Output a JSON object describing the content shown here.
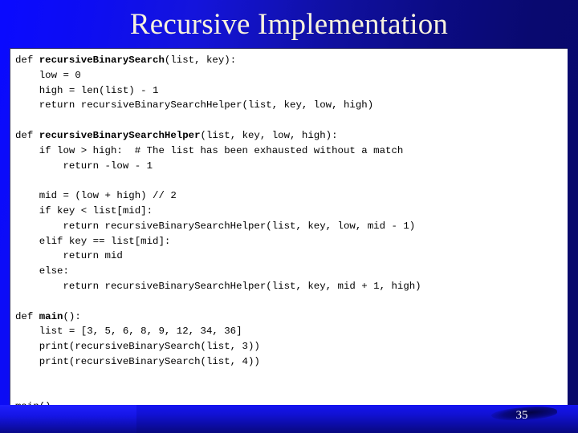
{
  "slide": {
    "title": "Recursive Implementation",
    "page_number": "35",
    "background_color_left": "#0a0aff",
    "background_color_right": "#08086a",
    "title_color": "#f7f2dd",
    "panel_background": "#ffffff",
    "code_text_color": "#000000"
  },
  "code": {
    "language": "python",
    "lines": [
      {
        "indent": 0,
        "prefix": "def ",
        "bold": "recursiveBinarySearch",
        "suffix": "(list, key):"
      },
      {
        "indent": 1,
        "prefix": "low = 0",
        "bold": "",
        "suffix": ""
      },
      {
        "indent": 1,
        "prefix": "high = len(list) - 1",
        "bold": "",
        "suffix": ""
      },
      {
        "indent": 1,
        "prefix": "return recursiveBinarySearchHelper(list, key, low, high)",
        "bold": "",
        "suffix": ""
      },
      {
        "indent": 0,
        "prefix": "",
        "bold": "",
        "suffix": ""
      },
      {
        "indent": 0,
        "prefix": "def ",
        "bold": "recursiveBinarySearchHelper",
        "suffix": "(list, key, low, high):"
      },
      {
        "indent": 1,
        "prefix": "if low > high:  # The list has been exhausted without a match",
        "bold": "",
        "suffix": ""
      },
      {
        "indent": 2,
        "prefix": "return -low - 1",
        "bold": "",
        "suffix": ""
      },
      {
        "indent": 0,
        "prefix": "",
        "bold": "",
        "suffix": ""
      },
      {
        "indent": 1,
        "prefix": "mid = (low + high) // 2",
        "bold": "",
        "suffix": ""
      },
      {
        "indent": 1,
        "prefix": "if key < list[mid]:",
        "bold": "",
        "suffix": ""
      },
      {
        "indent": 2,
        "prefix": "return recursiveBinarySearchHelper(list, key, low, mid - 1)",
        "bold": "",
        "suffix": ""
      },
      {
        "indent": 1,
        "prefix": "elif key == list[mid]:",
        "bold": "",
        "suffix": ""
      },
      {
        "indent": 2,
        "prefix": "return mid",
        "bold": "",
        "suffix": ""
      },
      {
        "indent": 1,
        "prefix": "else:",
        "bold": "",
        "suffix": ""
      },
      {
        "indent": 2,
        "prefix": "return recursiveBinarySearchHelper(list, key, mid + 1, high)",
        "bold": "",
        "suffix": ""
      },
      {
        "indent": 0,
        "prefix": "",
        "bold": "",
        "suffix": ""
      },
      {
        "indent": 0,
        "prefix": "def ",
        "bold": "main",
        "suffix": "():"
      },
      {
        "indent": 1,
        "prefix": "list = [3, 5, 6, 8, 9, 12, 34, 36]",
        "bold": "",
        "suffix": ""
      },
      {
        "indent": 1,
        "prefix": "print(recursiveBinarySearch(list, 3))",
        "bold": "",
        "suffix": ""
      },
      {
        "indent": 1,
        "prefix": "print(recursiveBinarySearch(list, 4))",
        "bold": "",
        "suffix": ""
      },
      {
        "indent": 0,
        "prefix": "",
        "bold": "",
        "suffix": ""
      },
      {
        "indent": 0,
        "prefix": "",
        "bold": "",
        "suffix": ""
      },
      {
        "indent": 0,
        "prefix": "main()",
        "bold": "",
        "suffix": ""
      }
    ]
  }
}
